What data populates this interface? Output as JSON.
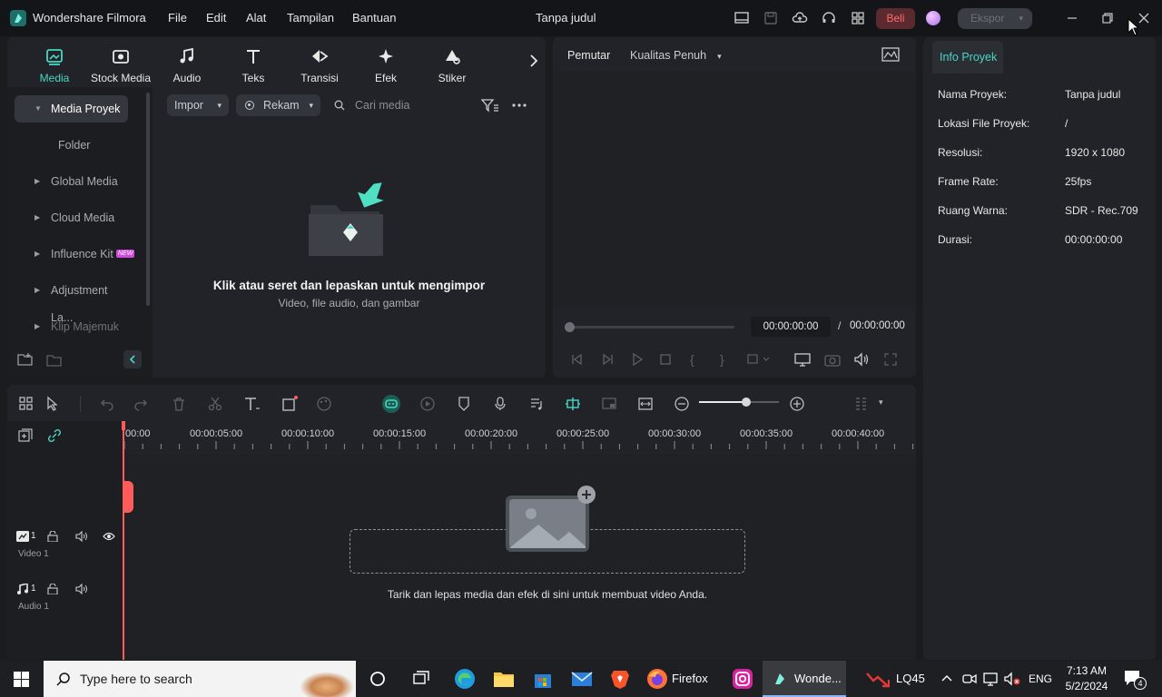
{
  "app": {
    "name": "Wondershare Filmora",
    "project_title": "Tanpa judul"
  },
  "menu": [
    "File",
    "Edit",
    "Alat",
    "Tampilan",
    "Bantuan"
  ],
  "titlebar_buttons": {
    "buy": "Beli",
    "export": "Ekspor"
  },
  "media_tabs": [
    {
      "label": "Media",
      "icon": "media-icon",
      "active": true
    },
    {
      "label": "Stock Media",
      "icon": "stock-media-icon"
    },
    {
      "label": "Audio",
      "icon": "music-note-icon"
    },
    {
      "label": "Teks",
      "icon": "text-icon"
    },
    {
      "label": "Transisi",
      "icon": "transition-icon"
    },
    {
      "label": "Efek",
      "icon": "effect-icon"
    },
    {
      "label": "Stiker",
      "icon": "sticker-icon"
    }
  ],
  "sidebar": {
    "items": [
      {
        "label": "Media Proyek",
        "active": true
      },
      {
        "label": "Folder"
      },
      {
        "label": "Global Media"
      },
      {
        "label": "Cloud Media"
      },
      {
        "label": "Influence Kit",
        "badge": "NEW"
      },
      {
        "label": "Adjustment La..."
      },
      {
        "label": "Klip Majemuk"
      }
    ]
  },
  "media_toolbar": {
    "import": "Impor",
    "record": "Rekam",
    "search_placeholder": "Cari media"
  },
  "media_empty": {
    "title": "Klik atau seret dan lepaskan untuk mengimpor",
    "subtitle": "Video, file audio, dan gambar"
  },
  "player": {
    "tab": "Pemutar",
    "quality": "Kualitas Penuh",
    "current_time": "00:00:00:00",
    "separator": "/",
    "total_time": "00:00:00:00",
    "progress": 0
  },
  "info": {
    "tab": "Info Proyek",
    "rows": [
      {
        "label": "Nama Proyek:",
        "value": "Tanpa judul"
      },
      {
        "label": "Lokasi File Proyek:",
        "value": "/"
      },
      {
        "label": "Resolusi:",
        "value": "1920 x 1080"
      },
      {
        "label": "Frame Rate:",
        "value": "25fps"
      },
      {
        "label": "Ruang Warna:",
        "value": "SDR - Rec.709"
      },
      {
        "label": "Durasi:",
        "value": "00:00:00:00"
      }
    ]
  },
  "timeline": {
    "ruler": [
      "00:00",
      "00:00:05:00",
      "00:00:10:00",
      "00:00:15:00",
      "00:00:20:00",
      "00:00:25:00",
      "00:00:30:00",
      "00:00:35:00",
      "00:00:40:00"
    ],
    "tracks": [
      {
        "type": "video",
        "index": "1",
        "label": "Video 1"
      },
      {
        "type": "audio",
        "index": "1",
        "label": "Audio 1"
      }
    ],
    "drop_hint": "Tarik dan lepas media dan efek di sini untuk membuat video Anda."
  },
  "taskbar": {
    "search_placeholder": "Type here to search",
    "apps": [
      {
        "label": "Firefox"
      },
      {
        "label": "Wonde..."
      }
    ],
    "weather": "LQ45",
    "language": "ENG",
    "time": "7:13 AM",
    "date": "5/2/2024",
    "notifications": "4"
  },
  "colors": {
    "accent": "#49d6c4",
    "background": "#1a1c20",
    "panel": "#212328",
    "playhead": "#ff5b5b"
  }
}
